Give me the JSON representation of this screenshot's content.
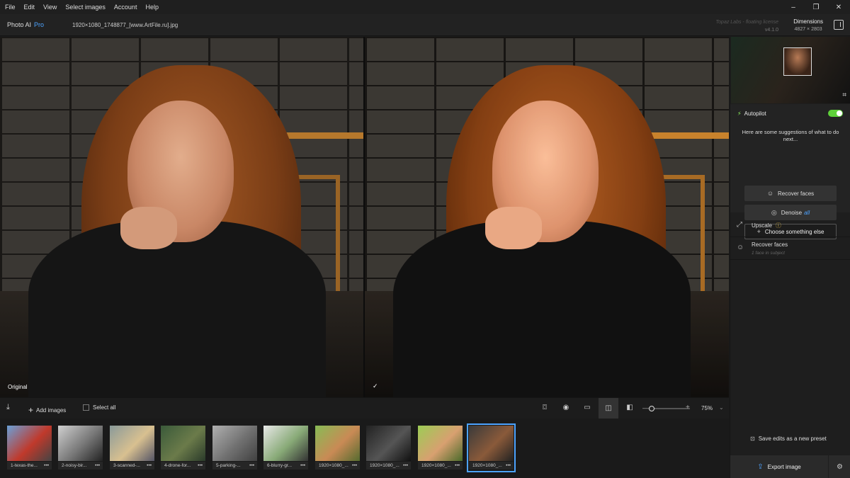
{
  "menu": [
    "File",
    "Edit",
    "View",
    "Select images",
    "Account",
    "Help"
  ],
  "window_controls": {
    "minimize": "–",
    "restore": "❐",
    "close": "✕"
  },
  "header": {
    "app_name": "Photo AI",
    "app_tier": "Pro",
    "filename": "1920×1080_1748877_[www.ArtFile.ru].jpg",
    "license": "Topaz Labs - floating license",
    "version": "v4.1.0",
    "dimensions_label": "Dimensions",
    "dimensions_value": "4827 × 2803"
  },
  "viewer": {
    "left_label": "Original",
    "right_label": "✓"
  },
  "panel": {
    "autopilot_label": "Autopilot",
    "autopilot_enabled": true,
    "suggestion_text": "Here are some suggestions of what to do next...",
    "buttons": {
      "recover_faces": "Recover faces",
      "denoise": "Denoise",
      "denoise_tag": "all",
      "choose": "Choose something else"
    },
    "tools": {
      "upscale": "Upscale",
      "recover_faces": "Recover faces",
      "recover_faces_sub": "1 face in subject"
    },
    "save_preset": "Save edits as a new preset",
    "export": "Export image"
  },
  "toolbar": {
    "add_images": "Add images",
    "select_all": "Select all",
    "zoom": "75%"
  },
  "filmstrip": [
    {
      "name": "1-texas-the...",
      "colors": [
        "#6aa0d8",
        "#c0392b",
        "#444"
      ]
    },
    {
      "name": "2-noisy-bir...",
      "colors": [
        "#d0d0d0",
        "#777",
        "#222"
      ]
    },
    {
      "name": "3-scanned-...",
      "colors": [
        "#8a9a9a",
        "#d8c090",
        "#556"
      ]
    },
    {
      "name": "4-drone-for...",
      "colors": [
        "#3a5a3a",
        "#6b7b4a",
        "#2a3a2a"
      ]
    },
    {
      "name": "5-parking-...",
      "colors": [
        "#b0b0b0",
        "#707070",
        "#404040"
      ]
    },
    {
      "name": "6-blurry-gr...",
      "colors": [
        "#e8e8e8",
        "#88aa77",
        "#333"
      ]
    },
    {
      "name": "1920×1080_...",
      "colors": [
        "#88bb55",
        "#c98a55",
        "#556b2f"
      ]
    },
    {
      "name": "1920×1080_...",
      "colors": [
        "#222",
        "#555",
        "#111"
      ]
    },
    {
      "name": "1920×1080_...",
      "colors": [
        "#9ccc55",
        "#d8a070",
        "#4a6a2a"
      ]
    },
    {
      "name": "1920×1080_...",
      "colors": [
        "#3a3a3a",
        "#8a5a3a",
        "#222"
      ]
    }
  ],
  "selected_thumb": 9,
  "accent": "#4da3ff"
}
